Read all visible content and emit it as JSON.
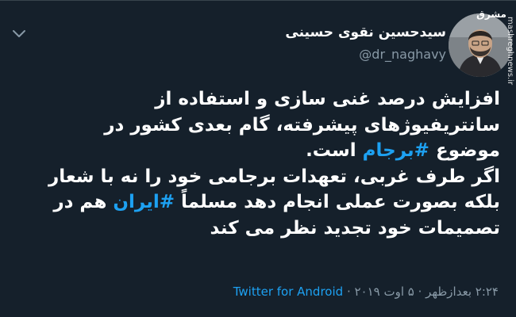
{
  "author": {
    "name": "سیدحسین نقوی حسینی",
    "handle": "@dr_naghavy"
  },
  "watermark": {
    "top": "مشرق",
    "side": "mashreghnews.ir"
  },
  "tweet": {
    "l1": "افزایش درصد غنی سازی و استفاده از",
    "l2": "سانتریفیوژهای پیشرفته، گام بعدی کشور در",
    "l3a": "موضوع ",
    "l3tag": "#برجام",
    "l3b": " است.",
    "l4": "اگر طرف غربی، تعهدات برجامی خود را نه با شعار",
    "l5a": "بلکه بصورت عملی انجام دهد مسلماً ",
    "l5tag": "#ایران",
    "l5b": " هم در",
    "l6": "تصمیمات خود تجدید نظر می کند"
  },
  "meta": {
    "time": "۲:۲۴ بعدازظهر",
    "sep1": " · ",
    "date": "۵ اوت ۲۰۱۹",
    "sep2": " · ",
    "source": "Twitter for Android"
  },
  "colors": {
    "background": "#15202b",
    "text": "#ffffff",
    "muted": "#8899a6",
    "link": "#1da1f2"
  },
  "icons": {
    "menu": "chevron-down-icon"
  }
}
